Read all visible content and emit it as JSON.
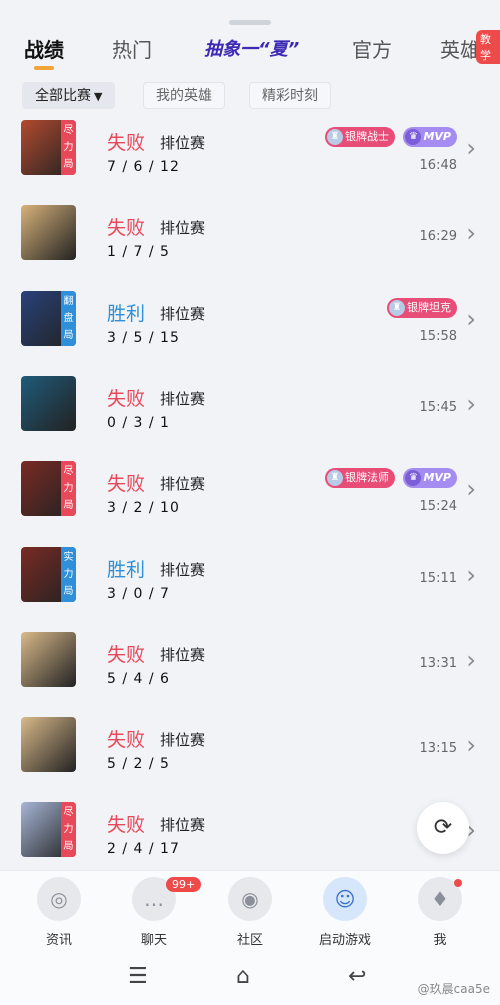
{
  "tabs": [
    {
      "label": "战绩"
    },
    {
      "label": "热门"
    },
    {
      "label": "抽象一“夏”"
    },
    {
      "label": "官方"
    },
    {
      "label": "英雄",
      "badge": "教学"
    }
  ],
  "filters": {
    "all_label": "全部比赛",
    "my_heroes_label": "我的英雄",
    "highlights_label": "精彩时刻"
  },
  "matches": [
    {
      "result": "失败",
      "mode": "排位赛",
      "kda": "7 / 6 / 12",
      "time": "16:48",
      "tag": "尽力局",
      "badges": [
        "银牌战士",
        "MVP"
      ]
    },
    {
      "result": "失败",
      "mode": "排位赛",
      "kda": "1 / 7 / 5",
      "time": "16:29",
      "tag": "",
      "badges": []
    },
    {
      "result": "胜利",
      "mode": "排位赛",
      "kda": "3 / 5 / 15",
      "time": "15:58",
      "tag": "翻盘局",
      "badges": [
        "银牌坦克"
      ]
    },
    {
      "result": "失败",
      "mode": "排位赛",
      "kda": "0 / 3 / 1",
      "time": "15:45",
      "tag": "",
      "badges": []
    },
    {
      "result": "失败",
      "mode": "排位赛",
      "kda": "3 / 2 / 10",
      "time": "15:24",
      "tag": "尽力局",
      "badges": [
        "银牌法师",
        "MVP"
      ]
    },
    {
      "result": "胜利",
      "mode": "排位赛",
      "kda": "3 / 0 / 7",
      "time": "15:11",
      "tag": "实力局",
      "badges": []
    },
    {
      "result": "失败",
      "mode": "排位赛",
      "kda": "5 / 4 / 6",
      "time": "13:31",
      "tag": "",
      "badges": []
    },
    {
      "result": "失败",
      "mode": "排位赛",
      "kda": "5 / 2 / 5",
      "time": "13:15",
      "tag": "",
      "badges": []
    },
    {
      "result": "失败",
      "mode": "排位赛",
      "kda": "2 / 4 / 17",
      "time": "",
      "tag": "尽力局",
      "badges": []
    }
  ],
  "bottom_nav": [
    {
      "label": "资讯",
      "icon": "news-icon"
    },
    {
      "label": "聊天",
      "icon": "chat-icon",
      "badge": "99+"
    },
    {
      "label": "社区",
      "icon": "community-icon"
    },
    {
      "label": "启动游戏",
      "icon": "launch-game-icon"
    },
    {
      "label": "我",
      "icon": "profile-icon"
    }
  ],
  "watermark": "@玖晨caa5e",
  "colors": {
    "lose": "#e8495a",
    "win": "#2f8fd8",
    "accent": "#f2a53a",
    "badge_red": "#ef4a4a"
  }
}
